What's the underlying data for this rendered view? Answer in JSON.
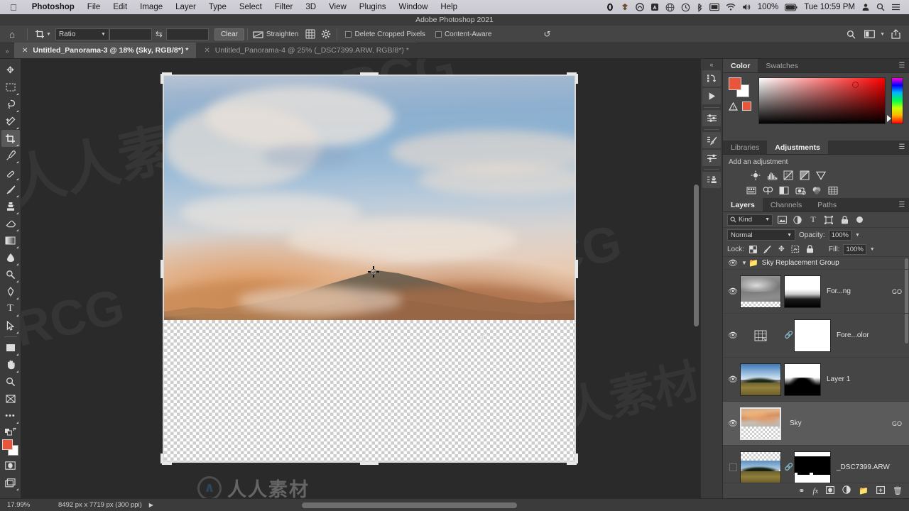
{
  "os_menu": {
    "apple_icon": "apple-icon",
    "items": [
      {
        "label": "Photoshop",
        "bold": true
      },
      {
        "label": "File",
        "bold": false
      },
      {
        "label": "Edit",
        "bold": false
      },
      {
        "label": "Image",
        "bold": false
      },
      {
        "label": "Layer",
        "bold": false
      },
      {
        "label": "Type",
        "bold": false
      },
      {
        "label": "Select",
        "bold": false
      },
      {
        "label": "Filter",
        "bold": false
      },
      {
        "label": "3D",
        "bold": false
      },
      {
        "label": "View",
        "bold": false
      },
      {
        "label": "Plugins",
        "bold": false
      },
      {
        "label": "Window",
        "bold": false
      },
      {
        "label": "Help",
        "bold": false
      }
    ],
    "status_icons": [
      "opera-icon",
      "dropbox-icon",
      "creative-cloud-icon",
      "adobe-icon",
      "globe-icon",
      "timemachine-icon",
      "bluetooth-icon",
      "display-icon",
      "wifi-icon",
      "volume-icon"
    ],
    "battery_percent": "100%",
    "clock": "Tue 10:59 PM",
    "user_icon": "user-icon",
    "spotlight_icon": "search-icon",
    "control_center_icon": "control-center-icon"
  },
  "window": {
    "title": "Adobe Photoshop 2021"
  },
  "options_bar": {
    "home_icon": "home-icon",
    "tool_icon": "crop-tool-icon",
    "ratio_label": "Ratio",
    "width_value": "",
    "height_value": "",
    "swap_icon": "swap-icon",
    "clear_label": "Clear",
    "straighten_label": "Straighten",
    "straighten_icon": "straighten-icon",
    "overlay_icon": "grid-overlay-icon",
    "settings_icon": "gear-icon",
    "delete_cropped_label": "Delete Cropped Pixels",
    "delete_cropped_checked": false,
    "content_aware_label": "Content-Aware",
    "content_aware_checked": false,
    "search_icon": "search-icon",
    "workspace_icon": "workspace-icon",
    "share_icon": "share-icon"
  },
  "tabs": {
    "overflow_icon": "chevron-double-icon",
    "items": [
      {
        "title": "Untitled_Panorama-3 @ 18% (Sky, RGB/8*) *",
        "active": true
      },
      {
        "title": "Untitled_Panorama-4 @ 25% (_DSC7399.ARW, RGB/8*) *",
        "active": false
      }
    ]
  },
  "toolbar": {
    "tools": [
      {
        "name": "move-tool",
        "glyph": "✥",
        "selected": false,
        "submenu": false
      },
      {
        "name": "marquee-tool",
        "glyph": "▭",
        "selected": false,
        "submenu": true
      },
      {
        "name": "lasso-tool",
        "glyph": "◯",
        "selected": false,
        "submenu": true
      },
      {
        "name": "quick-selection-tool",
        "glyph": "✦",
        "selected": false,
        "submenu": true
      },
      {
        "name": "crop-tool",
        "glyph": "⌗",
        "selected": true,
        "submenu": true
      },
      {
        "name": "eyedropper-tool",
        "glyph": "⚲",
        "selected": false,
        "submenu": true
      },
      {
        "name": "healing-brush-tool",
        "glyph": "✐",
        "selected": false,
        "submenu": true
      },
      {
        "name": "brush-tool",
        "glyph": "✎",
        "selected": false,
        "submenu": true
      },
      {
        "name": "clone-stamp-tool",
        "glyph": "⚒",
        "selected": false,
        "submenu": true
      },
      {
        "name": "eraser-tool",
        "glyph": "◣",
        "selected": false,
        "submenu": true
      },
      {
        "name": "gradient-tool",
        "glyph": "▤",
        "selected": false,
        "submenu": true
      },
      {
        "name": "blur-tool",
        "glyph": "💧",
        "selected": false,
        "submenu": true
      },
      {
        "name": "dodge-tool",
        "glyph": "⚭",
        "selected": false,
        "submenu": true
      },
      {
        "name": "pen-tool",
        "glyph": "✒",
        "selected": false,
        "submenu": true
      },
      {
        "name": "type-tool",
        "glyph": "T",
        "selected": false,
        "submenu": true
      },
      {
        "name": "path-selection-tool",
        "glyph": "➤",
        "selected": false,
        "submenu": true
      },
      {
        "name": "rectangle-tool",
        "glyph": "▢",
        "selected": false,
        "submenu": true
      },
      {
        "name": "hand-tool",
        "glyph": "✋",
        "selected": false,
        "submenu": true
      },
      {
        "name": "zoom-tool",
        "glyph": "⚲",
        "selected": false,
        "submenu": false
      },
      {
        "name": "frame-tool",
        "glyph": "⧄",
        "selected": false,
        "submenu": false
      },
      {
        "name": "edit-toolbar",
        "glyph": "•••",
        "selected": false,
        "submenu": false
      }
    ],
    "foreground_color": "#e8553a",
    "background_color": "#ffffff",
    "quickmask_icon": "quick-mask-icon",
    "screenmode_icon": "screen-mode-icon"
  },
  "dock_icons": [
    {
      "name": "collapse-panels-icon",
      "glyph": "«"
    },
    {
      "name": "history-actions-icon",
      "glyph": "⎘"
    },
    {
      "name": "play-actions-icon",
      "glyph": "▶"
    },
    {
      "name": "properties-icon",
      "glyph": "⚙"
    },
    {
      "name": "brush-settings-icon",
      "glyph": "✎"
    },
    {
      "name": "brush-presets-icon",
      "glyph": "⌁"
    },
    {
      "name": "clone-source-icon",
      "glyph": "⎙"
    }
  ],
  "color_panel": {
    "tabs": [
      {
        "label": "Color",
        "active": true
      },
      {
        "label": "Swatches",
        "active": false
      }
    ],
    "menu_icon": "panel-menu-icon",
    "foreground_color": "#e8553a",
    "background_color": "#ffffff",
    "out_of_gamut_icon": "gamut-warning-icon"
  },
  "adjustments_panel": {
    "tabs": [
      {
        "label": "Libraries",
        "active": false
      },
      {
        "label": "Adjustments",
        "active": true
      }
    ],
    "menu_icon": "panel-menu-icon",
    "heading": "Add an adjustment",
    "row1": [
      "brightness-contrast-icon",
      "levels-icon",
      "curves-icon",
      "exposure-icon",
      "vibrance-icon"
    ],
    "row2": [
      "hue-saturation-icon",
      "color-balance-icon",
      "black-white-icon",
      "photo-filter-icon",
      "channel-mixer-icon",
      "color-lookup-icon"
    ],
    "row3": [
      "invert-icon",
      "posterize-icon",
      "threshold-icon",
      "gradient-map-icon",
      "selective-color-icon"
    ]
  },
  "layers_panel": {
    "tabs": [
      {
        "label": "Layers",
        "active": true
      },
      {
        "label": "Channels",
        "active": false
      },
      {
        "label": "Paths",
        "active": false
      }
    ],
    "menu_icon": "panel-menu-icon",
    "filter_label": "Kind",
    "filter_icon": "search-icon",
    "filter_type_icons": [
      "pixel-filter-icon",
      "adjustment-filter-icon",
      "type-filter-icon",
      "shape-filter-icon",
      "smartobject-filter-icon"
    ],
    "filter_toggle_icon": "filter-toggle-icon",
    "blend_mode": "Normal",
    "opacity_label": "Opacity:",
    "opacity_value": "100%",
    "lock_label": "Lock:",
    "lock_icons": [
      "lock-transparent-icon",
      "lock-image-icon",
      "lock-position-icon",
      "lock-nesting-icon",
      "lock-all-icon"
    ],
    "fill_label": "Fill:",
    "fill_value": "100%",
    "group": {
      "name": "Sky Replacement Group",
      "expanded": true,
      "visible": true,
      "folder_icon": "folder-icon",
      "disclosure_icon": "chevron-down-icon"
    },
    "layers": [
      {
        "name": "For...ng",
        "visible": true,
        "selected": false,
        "has_mask": true,
        "linked": false,
        "badge": "GO",
        "thumb_kind": "fog"
      },
      {
        "name": "Fore...olor",
        "visible": true,
        "selected": false,
        "has_mask": true,
        "linked": true,
        "badge": "",
        "thumb_kind": "solid-fill"
      },
      {
        "name": "Layer 1",
        "visible": true,
        "selected": false,
        "has_mask": true,
        "linked": false,
        "badge": "",
        "thumb_kind": "landscape"
      },
      {
        "name": "Sky",
        "visible": true,
        "selected": true,
        "has_mask": false,
        "linked": false,
        "badge": "GO",
        "thumb_kind": "sunset"
      },
      {
        "name": "_DSC7399.ARW",
        "visible": false,
        "selected": false,
        "has_mask": true,
        "linked": true,
        "badge": "",
        "thumb_kind": "landscape-alpha"
      }
    ],
    "footer_icons": [
      "link-layers-icon",
      "layer-style-icon",
      "add-mask-icon",
      "new-adjustment-icon",
      "new-group-icon",
      "new-layer-icon",
      "delete-layer-icon"
    ]
  },
  "status_bar": {
    "zoom": "17.99%",
    "doc_size": "8492 px x 7719 px (300 ppi)",
    "expand_icon": "chevron-right-icon"
  },
  "canvas": {
    "crop_active": true,
    "reference_point_icon": "transform-reference-point-icon",
    "cursor_icon": "crop-cursor-icon",
    "watermarks": [
      "RRCG",
      "人人素材"
    ],
    "watermark_brand": "人人素材"
  }
}
